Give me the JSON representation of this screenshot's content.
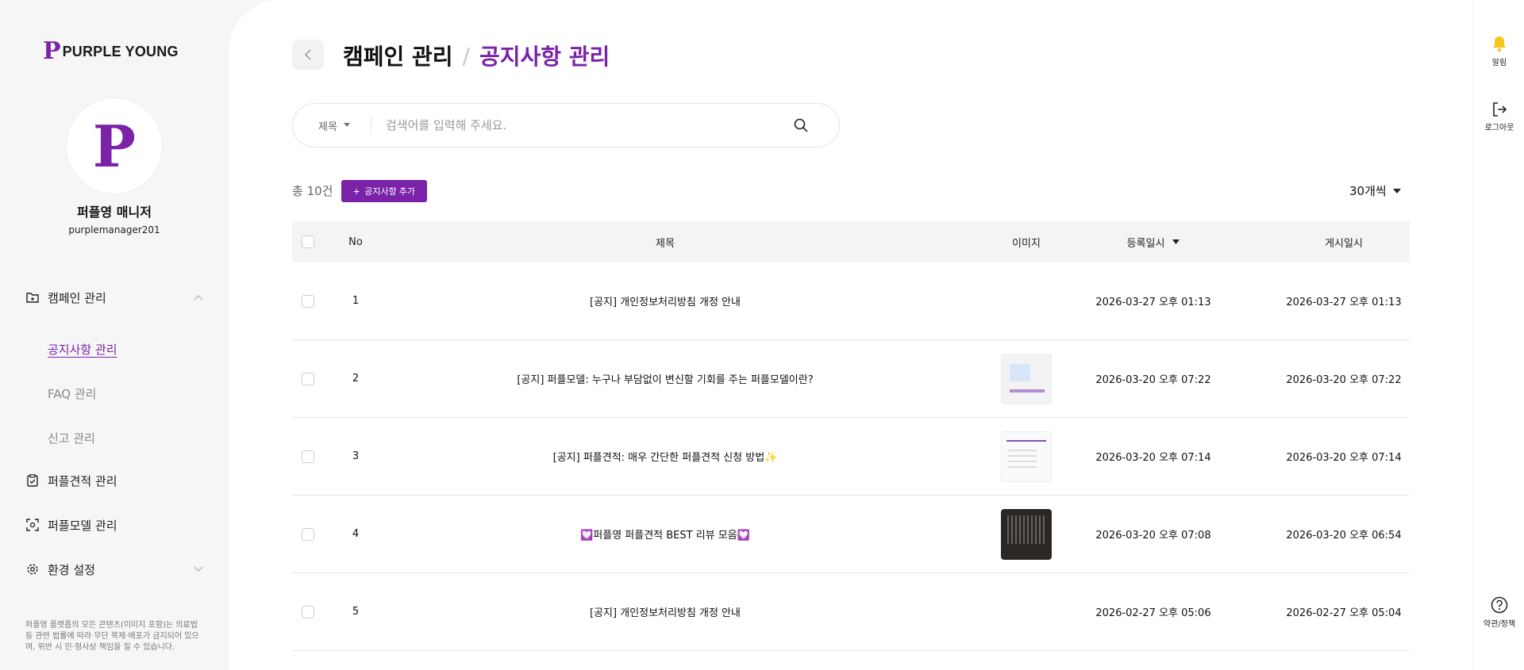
{
  "brand": {
    "mark": "P",
    "name": "PURPLE YOUNG",
    "accent": "#7a22a8"
  },
  "user": {
    "avatar_letter": "P",
    "name": "퍼플영 매니저",
    "id": "purplemanager201"
  },
  "nav": {
    "campaign": "캠페인 관리",
    "sub_items": [
      "공지사항 관리",
      "FAQ 관리",
      "신고 관리"
    ],
    "estimate": "퍼플견적 관리",
    "model": "퍼플모델 관리",
    "settings": "환경 설정"
  },
  "footer_notice": "퍼플영 플랫폼의 모든 콘텐츠(이미지 포함)는 의료법 등 관련 법률에 따라 무단 복제·배포가 금지되어 있으며, 위반 시 민·형사상 책임을 질 수 있습니다.",
  "header": {
    "parent": "캠페인 관리",
    "separator": "/",
    "current": "공지사항 관리"
  },
  "search": {
    "field": "제목",
    "placeholder": "검색어를 입력해 주세요."
  },
  "toolbar": {
    "total": "총 10건",
    "add_label": "공지사항 추가",
    "per_page": "30개씩"
  },
  "table": {
    "columns": {
      "no": "No",
      "title": "제목",
      "image": "이미지",
      "registered": "등록일시",
      "published": "게시일시"
    },
    "rows": [
      {
        "no": "1",
        "title": "[공지] 개인정보처리방침 개정 안내",
        "image": "none",
        "registered": "2026-03-27 오후 01:13",
        "published": "2026-03-27 오후 01:13"
      },
      {
        "no": "2",
        "title": "[공지] 퍼플모델: 누구나 부담없이 변신할 기회를 주는 퍼플모델이란?",
        "image": "light",
        "registered": "2026-03-20 오후 07:22",
        "published": "2026-03-20 오후 07:22"
      },
      {
        "no": "3",
        "title": "[공지] 퍼플견적: 매우 간단한 퍼플견적 신청 방법✨",
        "image": "form",
        "registered": "2026-03-20 오후 07:14",
        "published": "2026-03-20 오후 07:14"
      },
      {
        "no": "4",
        "title": "💟퍼플영 퍼플견적 BEST 리뷰 모음💟",
        "image": "dark",
        "registered": "2026-03-20 오후 07:08",
        "published": "2026-03-20 오후 06:54"
      },
      {
        "no": "5",
        "title": "[공지] 개인정보처리방침 개정 안내",
        "image": "none",
        "registered": "2026-02-27 오후 05:06",
        "published": "2026-02-27 오후 05:04"
      }
    ]
  },
  "rail": {
    "alert": "알림",
    "logout": "로그아웃",
    "terms": "약관/정책"
  }
}
